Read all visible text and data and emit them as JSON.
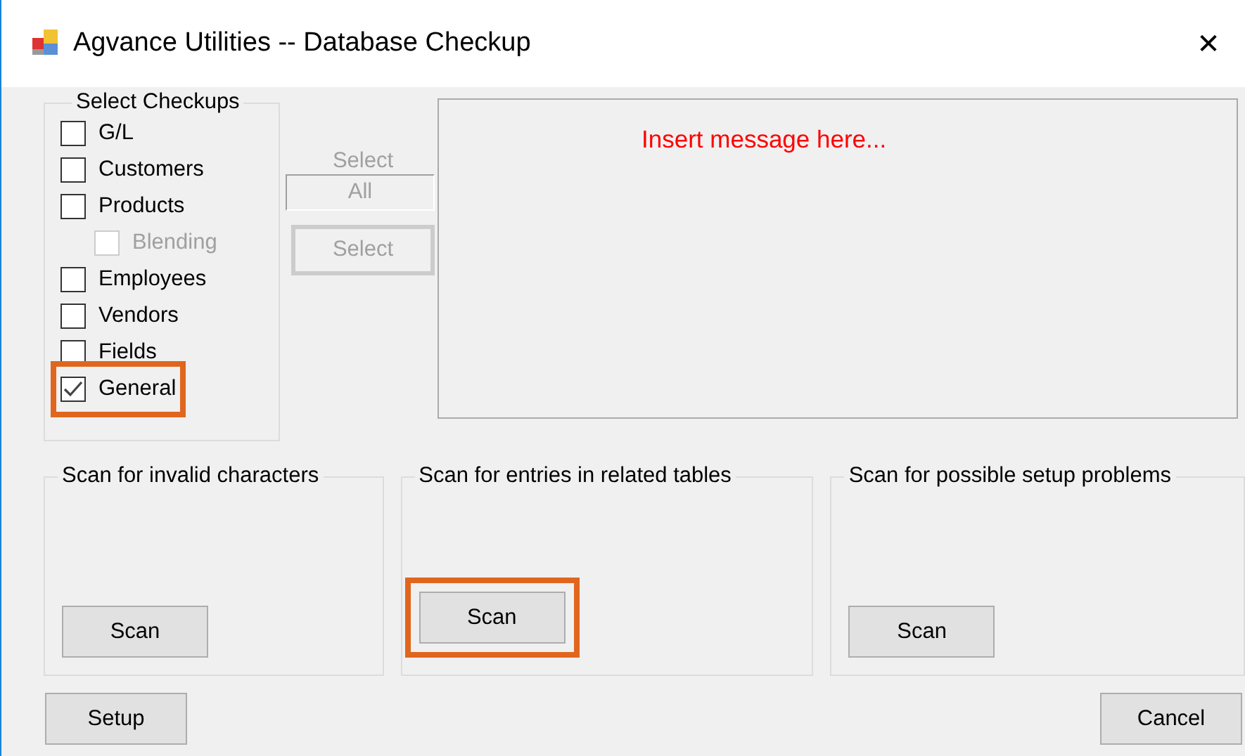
{
  "window": {
    "title": "Agvance Utilities -- Database Checkup",
    "close": "✕"
  },
  "checkups": {
    "title": "Select Checkups",
    "items": [
      {
        "label": "G/L",
        "checked": false,
        "disabled": false,
        "highlighted": false
      },
      {
        "label": "Customers",
        "checked": false,
        "disabled": false,
        "highlighted": false
      },
      {
        "label": "Products",
        "checked": false,
        "disabled": false,
        "highlighted": false,
        "children": [
          {
            "label": "Blending",
            "checked": false,
            "disabled": true,
            "highlighted": false
          }
        ]
      },
      {
        "label": "Employees",
        "checked": false,
        "disabled": false,
        "highlighted": false
      },
      {
        "label": "Vendors",
        "checked": false,
        "disabled": false,
        "highlighted": false
      },
      {
        "label": "Fields",
        "checked": false,
        "disabled": false,
        "highlighted": false
      },
      {
        "label": "General",
        "checked": true,
        "disabled": false,
        "highlighted": true
      }
    ]
  },
  "select_all": {
    "label": "Select",
    "value": "All",
    "disabled": true
  },
  "select_button": {
    "label": "Select",
    "disabled": true
  },
  "message": "Insert message here...",
  "scan_groups": [
    {
      "title": "Scan for invalid characters",
      "button": "Scan",
      "highlighted": false
    },
    {
      "title": "Scan for entries in related tables",
      "button": "Scan",
      "highlighted": true
    },
    {
      "title": "Scan for possible setup problems",
      "button": "Scan",
      "highlighted": false
    }
  ],
  "footer_buttons": [
    "Setup",
    "Cancel"
  ]
}
